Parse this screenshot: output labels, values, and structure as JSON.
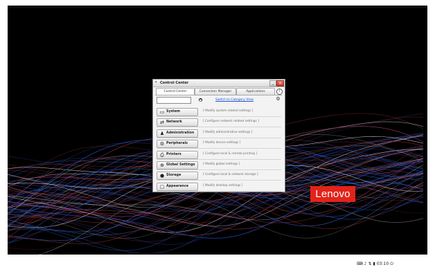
{
  "wallpaper": {
    "brand_logo": "Lenovo",
    "brand_color": "#e2231a",
    "wave_colors": [
      "#1e3f9c",
      "#3d6ee0",
      "#9a2b2b",
      "#d9d9e6",
      "#c44b7a"
    ]
  },
  "window": {
    "title": "Control Center",
    "icon": "app-tools-icon",
    "controls": {
      "minimize": "_",
      "close": "×"
    }
  },
  "tabs": [
    {
      "label": "Control Center",
      "active": true
    },
    {
      "label": "Connection Manager",
      "active": false
    },
    {
      "label": "Applications",
      "active": false
    }
  ],
  "toolbar": {
    "search_value": "",
    "switch_view_label": "Switch to Category View"
  },
  "rows": [
    {
      "label": "System",
      "desc": "[ Modify system related settings ]",
      "icon": "computer-icon",
      "glyph": "▭"
    },
    {
      "label": "Network",
      "desc": "[ Configure network related settings ]",
      "icon": "network-icon",
      "glyph": "⇄"
    },
    {
      "label": "Administration",
      "desc": "[ Modify administrative settings ]",
      "icon": "admin-user-icon",
      "glyph": "♟"
    },
    {
      "label": "Peripherals",
      "desc": "[ Modify device settings ]",
      "icon": "peripherals-icon",
      "glyph": "⚙"
    },
    {
      "label": "Printers",
      "desc": "[ Configure local & remote printing ]",
      "icon": "printer-icon",
      "glyph": "⎙"
    },
    {
      "label": "Global Settings",
      "desc": "[ Modify global settings ]",
      "icon": "globe-icon",
      "glyph": "⊕"
    },
    {
      "label": "Storage",
      "desc": "[ Configure local & network storage ]",
      "icon": "storage-disk-icon",
      "glyph": "●"
    },
    {
      "label": "Appearance",
      "desc": "[ Modify desktop settings ]",
      "icon": "monitor-icon",
      "glyph": "▢"
    }
  ],
  "tray": {
    "time": "03:10",
    "icons": [
      "keyboard-icon",
      "volume-icon",
      "network-tray-icon",
      "battery-icon",
      "power-icon"
    ]
  }
}
